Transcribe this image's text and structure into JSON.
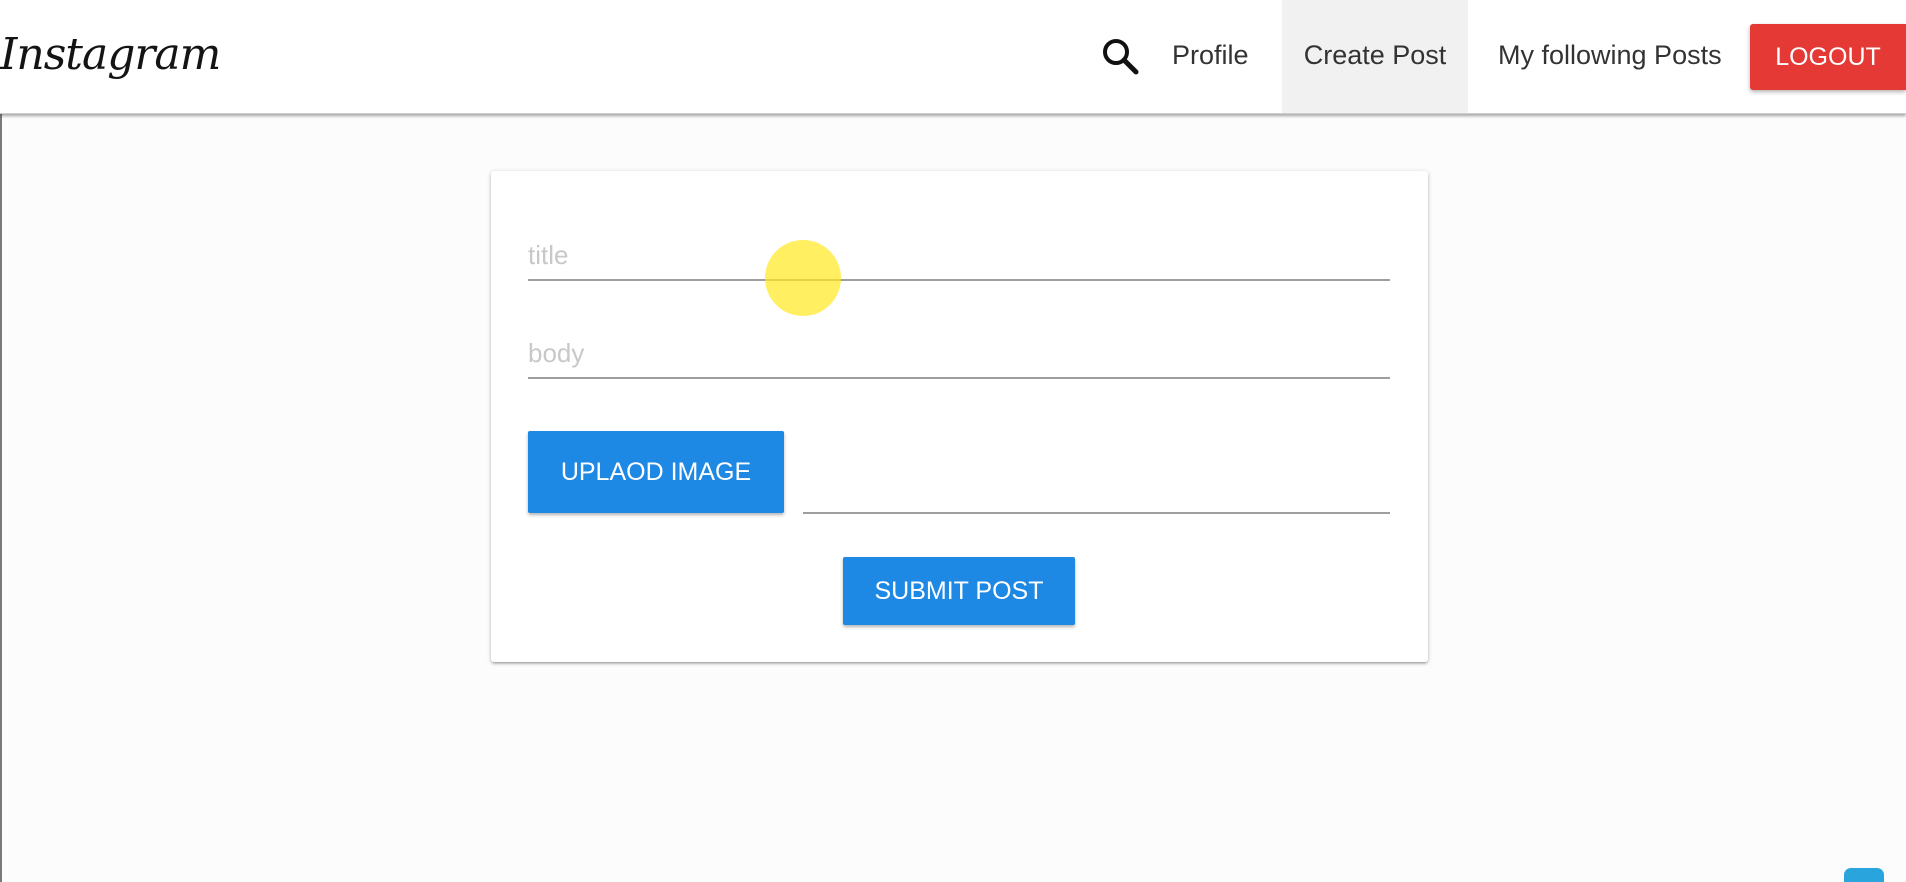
{
  "navbar": {
    "brand": "Instagram",
    "search_icon": "search-icon",
    "links": {
      "profile": "Profile",
      "create_post": "Create Post",
      "following": "My following Posts"
    },
    "logout_label": "LOGOUT"
  },
  "form": {
    "title_placeholder": "title",
    "title_value": "",
    "body_placeholder": "body",
    "body_value": "",
    "upload_label": "UPLAOD IMAGE",
    "file_path_value": "",
    "submit_label": "SUBMIT POST"
  },
  "colors": {
    "logout": "#e53935",
    "primary_button": "#1e88e5",
    "active_tab_bg": "#f1f1f1",
    "cursor_highlight": "#ffe81e"
  }
}
